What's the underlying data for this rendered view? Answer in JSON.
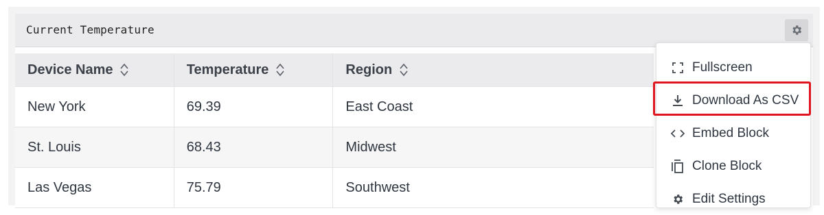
{
  "block": {
    "title": "Current Temperature",
    "settings_icon": "gear-icon"
  },
  "table": {
    "columns": [
      "Device Name",
      "Temperature",
      "Region"
    ],
    "rows": [
      {
        "device": "New York",
        "temperature": "69.39",
        "region": "East Coast"
      },
      {
        "device": "St. Louis",
        "temperature": "68.43",
        "region": "Midwest"
      },
      {
        "device": "Las Vegas",
        "temperature": "75.79",
        "region": "Southwest"
      }
    ]
  },
  "menu": {
    "items": [
      {
        "label": "Fullscreen",
        "icon": "fullscreen-icon"
      },
      {
        "label": "Download As CSV",
        "icon": "download-icon"
      },
      {
        "label": "Embed Block",
        "icon": "code-icon"
      },
      {
        "label": "Clone Block",
        "icon": "copy-icon"
      },
      {
        "label": "Edit Settings",
        "icon": "gear-icon"
      }
    ]
  },
  "colors": {
    "highlight": "#e0141e",
    "header_bg": "#ebebed"
  }
}
